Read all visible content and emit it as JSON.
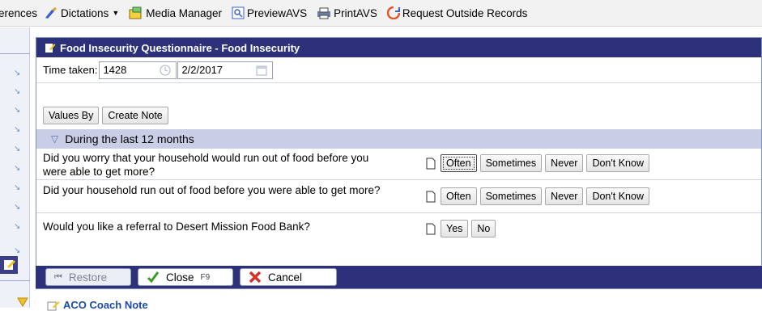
{
  "toolbar": {
    "items": [
      {
        "label": "erences"
      },
      {
        "label": "Dictations"
      },
      {
        "label": "Media Manager"
      },
      {
        "label": "PreviewAVS"
      },
      {
        "label": "PrintAVS"
      },
      {
        "label": "Request Outside Records"
      }
    ]
  },
  "panel": {
    "title": "Food Insecurity Questionnaire - Food Insecurity",
    "time_label": "Time taken:",
    "time_value": "1428",
    "date_value": "2/2/2017",
    "values_by_label": "Values By",
    "create_note_label": "Create Note",
    "section_title": "During the last 12 months",
    "questions": [
      {
        "text": "Did you worry that your household would run out of food before you were able to get more?",
        "options": [
          "Often",
          "Sometimes",
          "Never",
          "Don't Know"
        ]
      },
      {
        "text": "Did your household run out of food before you were able to get more?",
        "options": [
          "Often",
          "Sometimes",
          "Never",
          "Don't Know"
        ]
      },
      {
        "text": "Would you like a referral to Desert Mission Food Bank?",
        "options": [
          "Yes",
          "No"
        ]
      }
    ]
  },
  "footer": {
    "restore_label": "Restore",
    "close_label": "Close",
    "close_key": "F9",
    "cancel_label": "Cancel"
  },
  "bottom": {
    "link_label": "ACO Coach Note"
  },
  "colors": {
    "header_bg": "#2d3179",
    "section_bg": "#c9cde6",
    "accent": "#6d8fc7"
  }
}
